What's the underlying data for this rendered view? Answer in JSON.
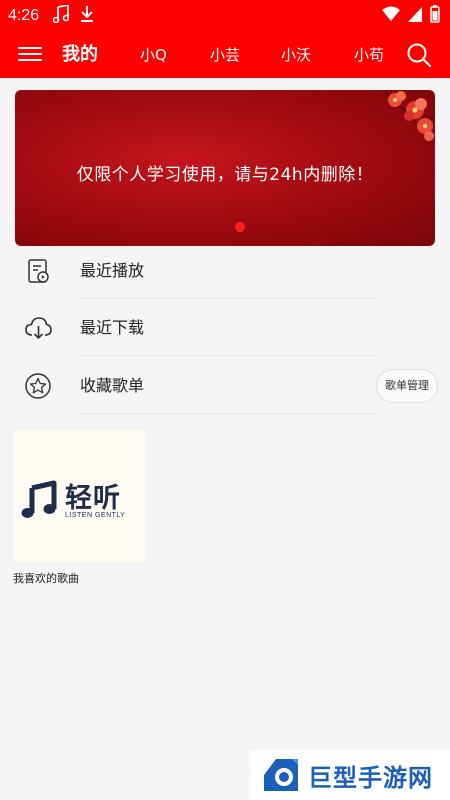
{
  "status_bar": {
    "time": "4:26",
    "left_icons": [
      "music-note-icon",
      "download-icon"
    ],
    "right_icons": [
      "wifi-icon",
      "cellular-signal-icon",
      "battery-icon"
    ]
  },
  "header": {
    "background": "#ff0000",
    "tabs": [
      {
        "label": "我的",
        "active": true
      },
      {
        "label": "小Q",
        "active": false
      },
      {
        "label": "小芸",
        "active": false
      },
      {
        "label": "小沃",
        "active": false
      },
      {
        "label": "小苟",
        "active": false
      }
    ],
    "left_icon": "menu-icon",
    "right_icon": "search-icon"
  },
  "banner": {
    "text": "仅限个人学习使用，请与24h内删除！",
    "page_indicator": {
      "count": 1,
      "active_index": 0
    }
  },
  "list": [
    {
      "label": "最近播放",
      "icon": "recent-play-icon"
    },
    {
      "label": "最近下载",
      "icon": "cloud-download-icon"
    },
    {
      "label": "收藏歌单",
      "icon": "star-icon"
    }
  ],
  "playlist_manage_button": "歌单管理",
  "playlists": [
    {
      "name": "我喜欢的歌曲",
      "cover_title": "轻听",
      "cover_subtitle": "LISTEN GENTLY"
    }
  ],
  "watermark": {
    "text": "巨型手游网",
    "color": "#1c5fb8"
  }
}
